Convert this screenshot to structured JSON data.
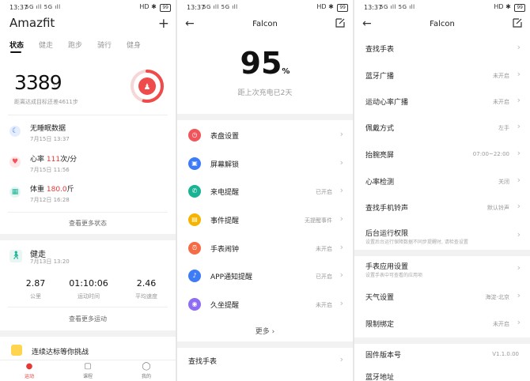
{
  "status_bar": {
    "time": "13:37",
    "signal": "5G ıll 5G ıll",
    "hd": "HD",
    "battery": "99"
  },
  "panel1": {
    "app_title": "Amazfit",
    "add": "+",
    "tabs": [
      "状态",
      "健走",
      "跑步",
      "骑行",
      "健身"
    ],
    "steps": "3389",
    "steps_sub": "距离达成目标还差4611步",
    "stats": [
      {
        "name": "无睡眠数据",
        "value": "",
        "unit": "",
        "date": "7月15日 13:37",
        "icon": "moon-icon",
        "color": "#3d7bf7"
      },
      {
        "name": "心率 ",
        "value": "111",
        "unit": "次/分",
        "date": "7月15日 11:56",
        "icon": "heart-icon",
        "color": "#f2545b"
      },
      {
        "name": "体重 ",
        "value": "180.0",
        "unit": "斤",
        "date": "7月12日 16:28",
        "icon": "scale-icon",
        "color": "#1ab394"
      }
    ],
    "more_status": "查看更多状态",
    "walk": {
      "title": "健走",
      "date": "7月13日 13:20"
    },
    "metrics": [
      {
        "value": "2.87",
        "label": "公里"
      },
      {
        "value": "01:10:06",
        "label": "运动时间"
      },
      {
        "value": "2.46",
        "label": "平均速度"
      }
    ],
    "more_sport": "查看更多运动",
    "challenge": "连续达标等你挑战",
    "nav": [
      {
        "label": "运动",
        "icon": "sport-icon"
      },
      {
        "label": "课程",
        "icon": "course-icon"
      },
      {
        "label": "我的",
        "icon": "profile-icon"
      }
    ]
  },
  "panel2": {
    "title": "Falcon",
    "battery": "95",
    "pct": "%",
    "battery_sub": "距上次充电已2天",
    "settings": [
      {
        "label": "表盘设置",
        "value": "",
        "color": "#f2545b",
        "icon": "watchface-icon"
      },
      {
        "label": "屏幕解锁",
        "value": "",
        "color": "#3d7bf7",
        "icon": "lock-icon"
      },
      {
        "label": "来电提醒",
        "value": "已开启",
        "color": "#1ab394",
        "icon": "phone-icon"
      },
      {
        "label": "事件提醒",
        "value": "无提醒事件",
        "color": "#f5b400",
        "icon": "event-icon"
      },
      {
        "label": "手表闹钟",
        "value": "未开启",
        "color": "#f46b45",
        "icon": "alarm-icon"
      },
      {
        "label": "APP通知提醒",
        "value": "已开启",
        "color": "#3d7bf7",
        "icon": "bell-icon"
      },
      {
        "label": "久坐提醒",
        "value": "未开启",
        "color": "#8e6cf3",
        "icon": "sit-icon"
      }
    ],
    "more": "更多",
    "find_watch": "查找手表"
  },
  "panel3": {
    "title": "Falcon",
    "rows": [
      {
        "label": "查找手表",
        "value": "",
        "desc": ""
      },
      {
        "label": "蓝牙广播",
        "value": "未开启",
        "desc": ""
      },
      {
        "label": "运动心率广播",
        "value": "未开启",
        "desc": ""
      },
      {
        "label": "佩戴方式",
        "value": "左手",
        "desc": ""
      },
      {
        "label": "抬腕亮屏",
        "value": "07:00~22:00",
        "desc": ""
      },
      {
        "label": "心率检测",
        "value": "关闭",
        "desc": ""
      },
      {
        "label": "查找手机铃声",
        "value": "默认铃声",
        "desc": ""
      },
      {
        "label": "后台运行权限",
        "value": "",
        "desc": "设置后台运行保障数据不同步提醒时, 请检查设置"
      },
      {
        "label": "手表应用设置",
        "value": "",
        "desc": "设置手表中可查看的应用项"
      },
      {
        "label": "天气设置",
        "value": "海淀-北京",
        "desc": ""
      },
      {
        "label": "限制绑定",
        "value": "未开启",
        "desc": ""
      },
      {
        "label": "固件版本号",
        "value": "V1.1.0.00",
        "desc": ""
      },
      {
        "label": "蓝牙地址",
        "value": "",
        "desc": ""
      }
    ]
  }
}
